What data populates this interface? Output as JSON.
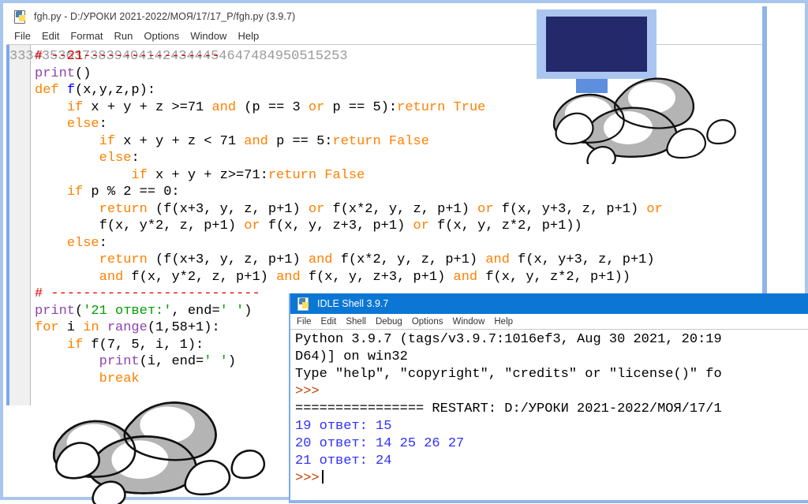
{
  "editor": {
    "icon": "python-file-icon",
    "title": "fgh.py - D:/УРОКИ 2021-2022/МОЯ/17/17_P/fgh.py (3.9.7)",
    "menu": [
      "File",
      "Edit",
      "Format",
      "Run",
      "Options",
      "Window",
      "Help"
    ],
    "line_numbers": [
      "33",
      "34",
      "35",
      "36",
      "37",
      "38",
      "39",
      "40",
      "41",
      "42",
      "43",
      "44",
      "45",
      "46",
      "47",
      "48",
      "49",
      "50",
      "51",
      "52",
      "53"
    ],
    "code_lines": [
      [
        {
          "t": "# --21-----------------",
          "c": "comment"
        }
      ],
      [
        {
          "t": "print",
          "c": "builtin"
        },
        {
          "t": "()",
          "c": "plain"
        }
      ],
      [
        {
          "t": "def",
          "c": "kw"
        },
        {
          "t": " ",
          "c": "plain"
        },
        {
          "t": "f",
          "c": "def"
        },
        {
          "t": "(x,y,z,p):",
          "c": "plain"
        }
      ],
      [
        {
          "t": "    ",
          "c": "plain"
        },
        {
          "t": "if",
          "c": "kw"
        },
        {
          "t": " x + y + z >=71 ",
          "c": "plain"
        },
        {
          "t": "and",
          "c": "kw"
        },
        {
          "t": " (p == 3 ",
          "c": "plain"
        },
        {
          "t": "or",
          "c": "kw"
        },
        {
          "t": " p == 5):",
          "c": "plain"
        },
        {
          "t": "return",
          "c": "kw"
        },
        {
          "t": " ",
          "c": "plain"
        },
        {
          "t": "True",
          "c": "kw"
        }
      ],
      [
        {
          "t": "    ",
          "c": "plain"
        },
        {
          "t": "else",
          "c": "kw"
        },
        {
          "t": ":",
          "c": "plain"
        }
      ],
      [
        {
          "t": "        ",
          "c": "plain"
        },
        {
          "t": "if",
          "c": "kw"
        },
        {
          "t": " x + y + z < 71 ",
          "c": "plain"
        },
        {
          "t": "and",
          "c": "kw"
        },
        {
          "t": " p == 5:",
          "c": "plain"
        },
        {
          "t": "return",
          "c": "kw"
        },
        {
          "t": " ",
          "c": "plain"
        },
        {
          "t": "False",
          "c": "kw"
        }
      ],
      [
        {
          "t": "        ",
          "c": "plain"
        },
        {
          "t": "else",
          "c": "kw"
        },
        {
          "t": ":",
          "c": "plain"
        }
      ],
      [
        {
          "t": "            ",
          "c": "plain"
        },
        {
          "t": "if",
          "c": "kw"
        },
        {
          "t": " x + y + z>=71:",
          "c": "plain"
        },
        {
          "t": "return",
          "c": "kw"
        },
        {
          "t": " ",
          "c": "plain"
        },
        {
          "t": "False",
          "c": "kw"
        }
      ],
      [
        {
          "t": "    ",
          "c": "plain"
        },
        {
          "t": "if",
          "c": "kw"
        },
        {
          "t": " p % 2 == 0:",
          "c": "plain"
        }
      ],
      [
        {
          "t": "        ",
          "c": "plain"
        },
        {
          "t": "return",
          "c": "kw"
        },
        {
          "t": " (f(x+3, y, z, p+1) ",
          "c": "plain"
        },
        {
          "t": "or",
          "c": "kw"
        },
        {
          "t": " f(x*2, y, z, p+1) ",
          "c": "plain"
        },
        {
          "t": "or",
          "c": "kw"
        },
        {
          "t": " f(x, y+3, z, p+1) ",
          "c": "plain"
        },
        {
          "t": "or",
          "c": "kw"
        }
      ],
      [
        {
          "t": "        f(x, y*2, z, p+1) ",
          "c": "plain"
        },
        {
          "t": "or",
          "c": "kw"
        },
        {
          "t": " f(x, y, z+3, p+1) ",
          "c": "plain"
        },
        {
          "t": "or",
          "c": "kw"
        },
        {
          "t": " f(x, y, z*2, p+1))",
          "c": "plain"
        }
      ],
      [
        {
          "t": "    ",
          "c": "plain"
        },
        {
          "t": "else",
          "c": "kw"
        },
        {
          "t": ":",
          "c": "plain"
        }
      ],
      [
        {
          "t": "        ",
          "c": "plain"
        },
        {
          "t": "return",
          "c": "kw"
        },
        {
          "t": " (f(x+3, y, z, p+1) ",
          "c": "plain"
        },
        {
          "t": "and",
          "c": "kw"
        },
        {
          "t": " f(x*2, y, z, p+1) ",
          "c": "plain"
        },
        {
          "t": "and",
          "c": "kw"
        },
        {
          "t": " f(x, y+3, z, p+1)",
          "c": "plain"
        }
      ],
      [
        {
          "t": "        ",
          "c": "plain"
        },
        {
          "t": "and",
          "c": "kw"
        },
        {
          "t": " f(x, y*2, z, p+1) ",
          "c": "plain"
        },
        {
          "t": "and",
          "c": "kw"
        },
        {
          "t": " f(x, y, z+3, p+1) ",
          "c": "plain"
        },
        {
          "t": "and",
          "c": "kw"
        },
        {
          "t": " f(x, y, z*2, p+1))",
          "c": "plain"
        }
      ],
      [
        {
          "t": "# --------------------------",
          "c": "comment"
        }
      ],
      [
        {
          "t": "print",
          "c": "builtin"
        },
        {
          "t": "(",
          "c": "plain"
        },
        {
          "t": "'21 ответ:'",
          "c": "str"
        },
        {
          "t": ", end=",
          "c": "plain"
        },
        {
          "t": "' '",
          "c": "str"
        },
        {
          "t": ")",
          "c": "plain"
        }
      ],
      [
        {
          "t": "for",
          "c": "kw"
        },
        {
          "t": " i ",
          "c": "plain"
        },
        {
          "t": "in",
          "c": "kw"
        },
        {
          "t": " ",
          "c": "plain"
        },
        {
          "t": "range",
          "c": "builtin"
        },
        {
          "t": "(1,58+1):",
          "c": "plain"
        }
      ],
      [
        {
          "t": "    ",
          "c": "plain"
        },
        {
          "t": "if",
          "c": "kw"
        },
        {
          "t": " f(7, 5, i, 1):",
          "c": "plain"
        }
      ],
      [
        {
          "t": "        ",
          "c": "plain"
        },
        {
          "t": "print",
          "c": "builtin"
        },
        {
          "t": "(i, end=",
          "c": "plain"
        },
        {
          "t": "' '",
          "c": "str"
        },
        {
          "t": ")",
          "c": "plain"
        }
      ],
      [
        {
          "t": "        ",
          "c": "plain"
        },
        {
          "t": "break",
          "c": "kw"
        }
      ],
      [
        {
          "t": "",
          "c": "plain"
        }
      ]
    ]
  },
  "shell": {
    "icon": "python-shell-icon",
    "title": "IDLE Shell 3.9.7",
    "menu": [
      "File",
      "Edit",
      "Shell",
      "Debug",
      "Options",
      "Window",
      "Help"
    ],
    "lines": [
      [
        {
          "t": "Python 3.9.7 (tags/v3.9.7:1016ef3, Aug 30 2021, 20:19",
          "c": "normal"
        }
      ],
      [
        {
          "t": "D64)] on win32",
          "c": "normal"
        }
      ],
      [
        {
          "t": "Type \"help\", \"copyright\", \"credits\" or \"license()\" fo",
          "c": "normal"
        }
      ],
      [
        {
          "t": ">>>",
          "c": "prompt"
        }
      ],
      [
        {
          "t": "================ RESTART: D:/УРОКИ 2021-2022/МОЯ/17/1",
          "c": "restart"
        }
      ],
      [
        {
          "t": "19 ответ: 15",
          "c": "out"
        }
      ],
      [
        {
          "t": "20 ответ: 14 25 26 27",
          "c": "out"
        }
      ],
      [
        {
          "t": "21 ответ: 24",
          "c": "out"
        }
      ],
      [
        {
          "t": ">>>",
          "c": "prompt",
          "caret": true
        }
      ]
    ]
  },
  "decor": {
    "monitor_label": "computer-monitor-illustration",
    "stones_top_label": "stone-pile-illustration-top",
    "stones_bottom_label": "stone-pile-illustration-bottom"
  },
  "colors": {
    "shell_titlebar": "#0c76d4",
    "frame_border": "#a8c6ee",
    "keyword": "#ff8000",
    "comment": "#dd0000",
    "string": "#00a000",
    "builtin": "#8e44ad",
    "definition": "#0000ff",
    "shell_output": "#3030ff",
    "shell_prompt": "#c04000",
    "monitor_screen": "#23296b",
    "monitor_bezel": "#aac6f0",
    "stone_fill": "#b4b4b4"
  }
}
